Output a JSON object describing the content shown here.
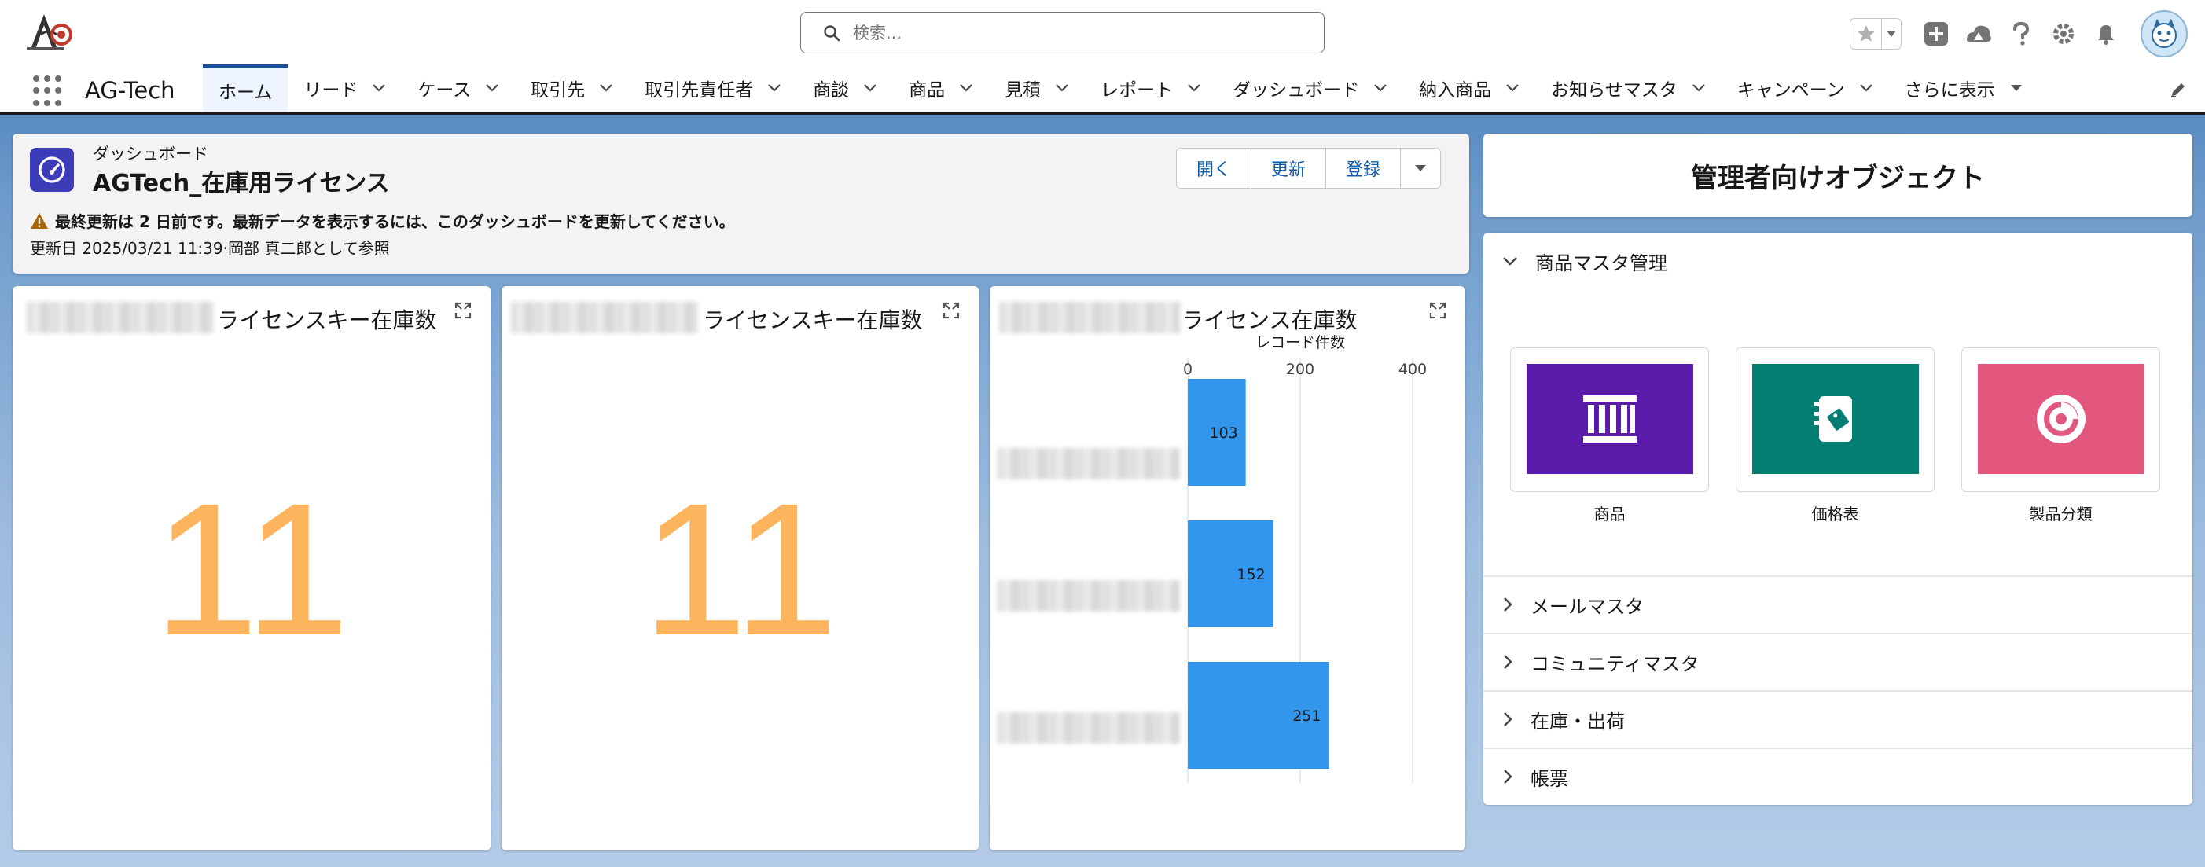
{
  "app": {
    "name": "AG-Tech"
  },
  "search": {
    "placeholder": "検索..."
  },
  "nav": {
    "tabs": [
      {
        "label": "ホーム"
      },
      {
        "label": "リード"
      },
      {
        "label": "ケース"
      },
      {
        "label": "取引先"
      },
      {
        "label": "取引先責任者"
      },
      {
        "label": "商談"
      },
      {
        "label": "商品"
      },
      {
        "label": "見積"
      },
      {
        "label": "レポート"
      },
      {
        "label": "ダッシュボード"
      },
      {
        "label": "納入商品"
      },
      {
        "label": "お知らせマスタ"
      },
      {
        "label": "キャンペーン"
      },
      {
        "label": "さらに表示"
      }
    ]
  },
  "dashboard": {
    "type_label": "ダッシュボード",
    "title": "AGTech_在庫用ライセンス",
    "buttons": {
      "open": "開く",
      "refresh": "更新",
      "subscribe": "登録"
    },
    "warning": "最終更新は 2 日前です。最新データを表示するには、このダッシュボードを更新してください。",
    "updated": "更新日 2025/03/21 11:39·岡部 真二郎として参照"
  },
  "widgets": {
    "w1": {
      "title_suffix": "ライセンスキー在庫数",
      "value": "11"
    },
    "w2": {
      "title_suffix": "ライセンスキー在庫数",
      "value": "11"
    },
    "w3": {
      "title_suffix": "ライセンス在庫数"
    }
  },
  "chart_data": {
    "type": "bar",
    "orientation": "horizontal",
    "title": "ライセンス在庫数",
    "xlabel": "レコード件数",
    "xticks": [
      0,
      200,
      400
    ],
    "xlim": [
      0,
      400
    ],
    "values": [
      103,
      152,
      251
    ],
    "bar_color": "#3296ed"
  },
  "admin": {
    "title": "管理者向けオブジェクト",
    "sections": [
      {
        "label": "商品マスタ管理",
        "expanded": true
      },
      {
        "label": "メールマスタ",
        "expanded": false
      },
      {
        "label": "コミュニティマスタ",
        "expanded": false
      },
      {
        "label": "在庫・出荷",
        "expanded": false
      },
      {
        "label": "帳票",
        "expanded": false
      }
    ],
    "tiles": [
      {
        "label": "商品",
        "color": "#5a1ba9",
        "icon": "product-icon"
      },
      {
        "label": "価格表",
        "color": "#047d72",
        "icon": "pricebook-icon"
      },
      {
        "label": "製品分類",
        "color": "#e3577f",
        "icon": "product-category-icon"
      }
    ]
  },
  "colors": {
    "accent": "#1b5297",
    "metric": "#fdb55d",
    "link": "#0b5cab",
    "dashboard_icon": "#3c3cb8"
  }
}
